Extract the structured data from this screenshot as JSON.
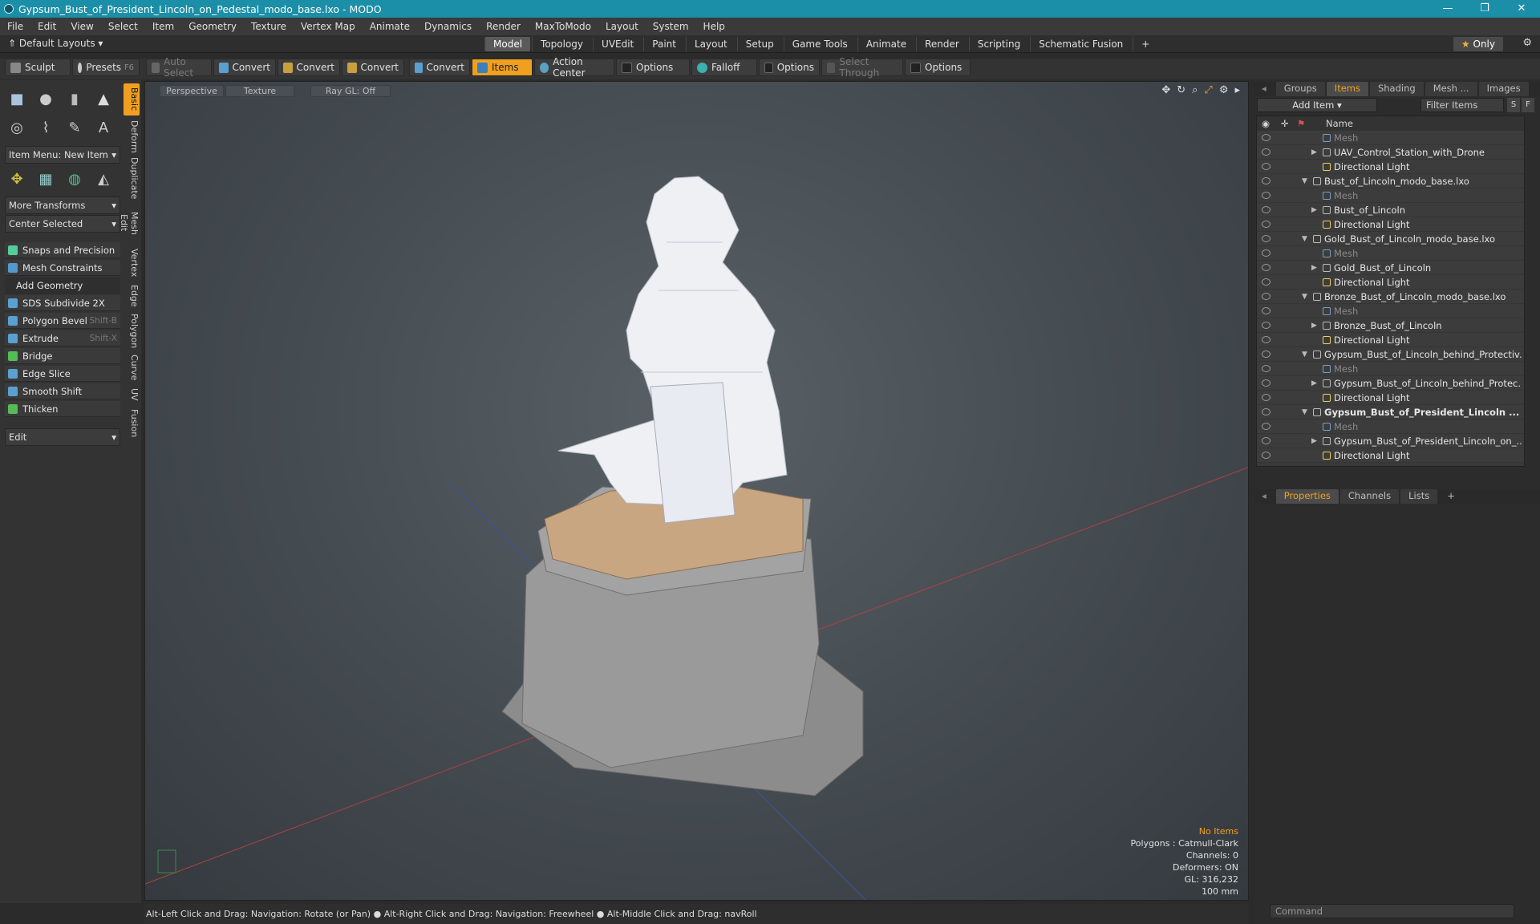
{
  "window": {
    "title": "Gypsum_Bust_of_President_Lincoln_on_Pedestal_modo_base.lxo - MODO"
  },
  "menu": [
    "File",
    "Edit",
    "View",
    "Select",
    "Item",
    "Geometry",
    "Texture",
    "Vertex Map",
    "Animate",
    "Dynamics",
    "Render",
    "MaxToModo",
    "Layout",
    "System",
    "Help"
  ],
  "layoutbar": {
    "default_layouts": "Default Layouts",
    "tabs": [
      "Model",
      "Topology",
      "UVEdit",
      "Paint",
      "Layout",
      "Setup",
      "Game Tools",
      "Animate",
      "Render",
      "Scripting",
      "Schematic Fusion"
    ],
    "active_tab": "Model",
    "only_label": "Only"
  },
  "toolbar": {
    "sculpt": "Sculpt",
    "presets": "Presets",
    "presets_key": "F6",
    "auto_select": "Auto Select",
    "convert": "Convert",
    "items": "Items",
    "action_center": "Action Center",
    "options": "Options",
    "falloff": "Falloff",
    "select_through": "Select Through"
  },
  "leftpanel": {
    "item_menu": "Item Menu: New Item",
    "more_transforms": "More Transforms",
    "center_selected": "Center Selected",
    "snaps": "Snaps and Precision",
    "mesh_constraints": "Mesh Constraints",
    "add_geometry": "Add Geometry",
    "tools": [
      {
        "label": "SDS Subdivide 2X",
        "shortcut": ""
      },
      {
        "label": "Polygon Bevel",
        "shortcut": "Shift-B"
      },
      {
        "label": "Extrude",
        "shortcut": "Shift-X"
      },
      {
        "label": "Bridge",
        "shortcut": ""
      },
      {
        "label": "Edge Slice",
        "shortcut": ""
      },
      {
        "label": "Smooth Shift",
        "shortcut": ""
      },
      {
        "label": "Thicken",
        "shortcut": ""
      }
    ],
    "edit": "Edit",
    "vtabs": [
      "Basic",
      "Deform",
      "Duplicate",
      "Mesh Edit",
      "Vertex",
      "Edge",
      "Polygon",
      "Curve",
      "UV",
      "Fusion"
    ]
  },
  "viewport": {
    "perspective": "Perspective",
    "texture": "Texture",
    "raygl": "Ray GL: Off",
    "stats": {
      "no_items": "No Items",
      "polygons": "Polygons : Catmull-Clark",
      "channels": "Channels: 0",
      "deformers": "Deformers: ON",
      "gl": "GL: 316,232",
      "scale": "100 mm"
    }
  },
  "rightpanel": {
    "tabs": [
      "Groups",
      "Items",
      "Shading",
      "Mesh ...",
      "Images"
    ],
    "active_tab": "Items",
    "add_item": "Add Item",
    "filter_items": "Filter Items",
    "name_header": "Name",
    "tree": [
      {
        "label": "Mesh",
        "level": 2,
        "type": "mesh",
        "dim": true
      },
      {
        "label": "UAV_Control_Station_with_Drone",
        "level": 2,
        "type": "group",
        "arrow": "right"
      },
      {
        "label": "Directional Light",
        "level": 2,
        "type": "light"
      },
      {
        "label": "Bust_of_Lincoln_modo_base.lxo",
        "level": 1,
        "type": "scene",
        "arrow": "down"
      },
      {
        "label": "Mesh",
        "level": 2,
        "type": "mesh",
        "dim": true
      },
      {
        "label": "Bust_of_Lincoln",
        "level": 2,
        "type": "group",
        "arrow": "right"
      },
      {
        "label": "Directional Light",
        "level": 2,
        "type": "light"
      },
      {
        "label": "Gold_Bust_of_Lincoln_modo_base.lxo",
        "level": 1,
        "type": "scene",
        "arrow": "down"
      },
      {
        "label": "Mesh",
        "level": 2,
        "type": "mesh",
        "dim": true
      },
      {
        "label": "Gold_Bust_of_Lincoln",
        "level": 2,
        "type": "group",
        "arrow": "right"
      },
      {
        "label": "Directional Light",
        "level": 2,
        "type": "light"
      },
      {
        "label": "Bronze_Bust_of_Lincoln_modo_base.lxo",
        "level": 1,
        "type": "scene",
        "arrow": "down"
      },
      {
        "label": "Mesh",
        "level": 2,
        "type": "mesh",
        "dim": true
      },
      {
        "label": "Bronze_Bust_of_Lincoln",
        "level": 2,
        "type": "group",
        "arrow": "right"
      },
      {
        "label": "Directional Light",
        "level": 2,
        "type": "light"
      },
      {
        "label": "Gypsum_Bust_of_Lincoln_behind_Protectiv...",
        "level": 1,
        "type": "scene",
        "arrow": "down"
      },
      {
        "label": "Mesh",
        "level": 2,
        "type": "mesh",
        "dim": true
      },
      {
        "label": "Gypsum_Bust_of_Lincoln_behind_Protec...",
        "level": 2,
        "type": "group",
        "arrow": "right"
      },
      {
        "label": "Directional Light",
        "level": 2,
        "type": "light"
      },
      {
        "label": "Gypsum_Bust_of_President_Lincoln ...",
        "level": 1,
        "type": "scene",
        "arrow": "down",
        "bold": true
      },
      {
        "label": "Mesh",
        "level": 2,
        "type": "mesh",
        "dim": true
      },
      {
        "label": "Gypsum_Bust_of_President_Lincoln_on_...",
        "level": 2,
        "type": "group",
        "arrow": "right"
      },
      {
        "label": "Directional Light",
        "level": 2,
        "type": "light"
      }
    ],
    "bottom_tabs": [
      "Properties",
      "Channels",
      "Lists"
    ],
    "command_placeholder": "Command"
  },
  "statusbar": "Alt-Left Click and Drag: Navigation: Rotate (or Pan) ● Alt-Right Click and Drag: Navigation: Freewheel ● Alt-Middle Click and Drag: navRoll"
}
